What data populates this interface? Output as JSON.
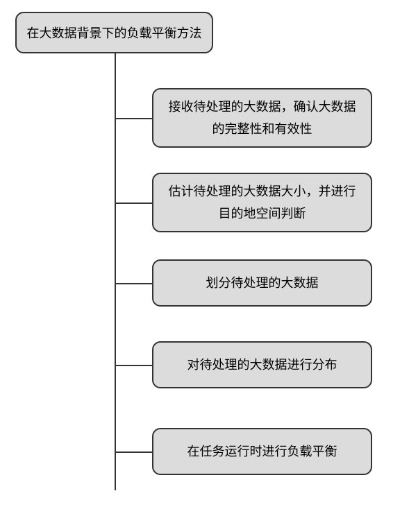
{
  "diagram": {
    "root": "在大数据背景下的负载平衡方法",
    "children": [
      "接收待处理的大数据，确认大数据的完整性和有效性",
      "估计待处理的大数据大小，并进行目的地空间判断",
      "划分待处理的大数据",
      "对待处理的大数据进行分布",
      "在任务运行时进行负载平衡"
    ]
  },
  "chart_data": {
    "type": "tree",
    "root": "在大数据背景下的负载平衡方法",
    "children": [
      "接收待处理的大数据，确认大数据的完整性和有效性",
      "估计待处理的大数据大小，并进行目的地空间判断",
      "划分待处理的大数据",
      "对待处理的大数据进行分布",
      "在任务运行时进行负载平衡"
    ]
  }
}
